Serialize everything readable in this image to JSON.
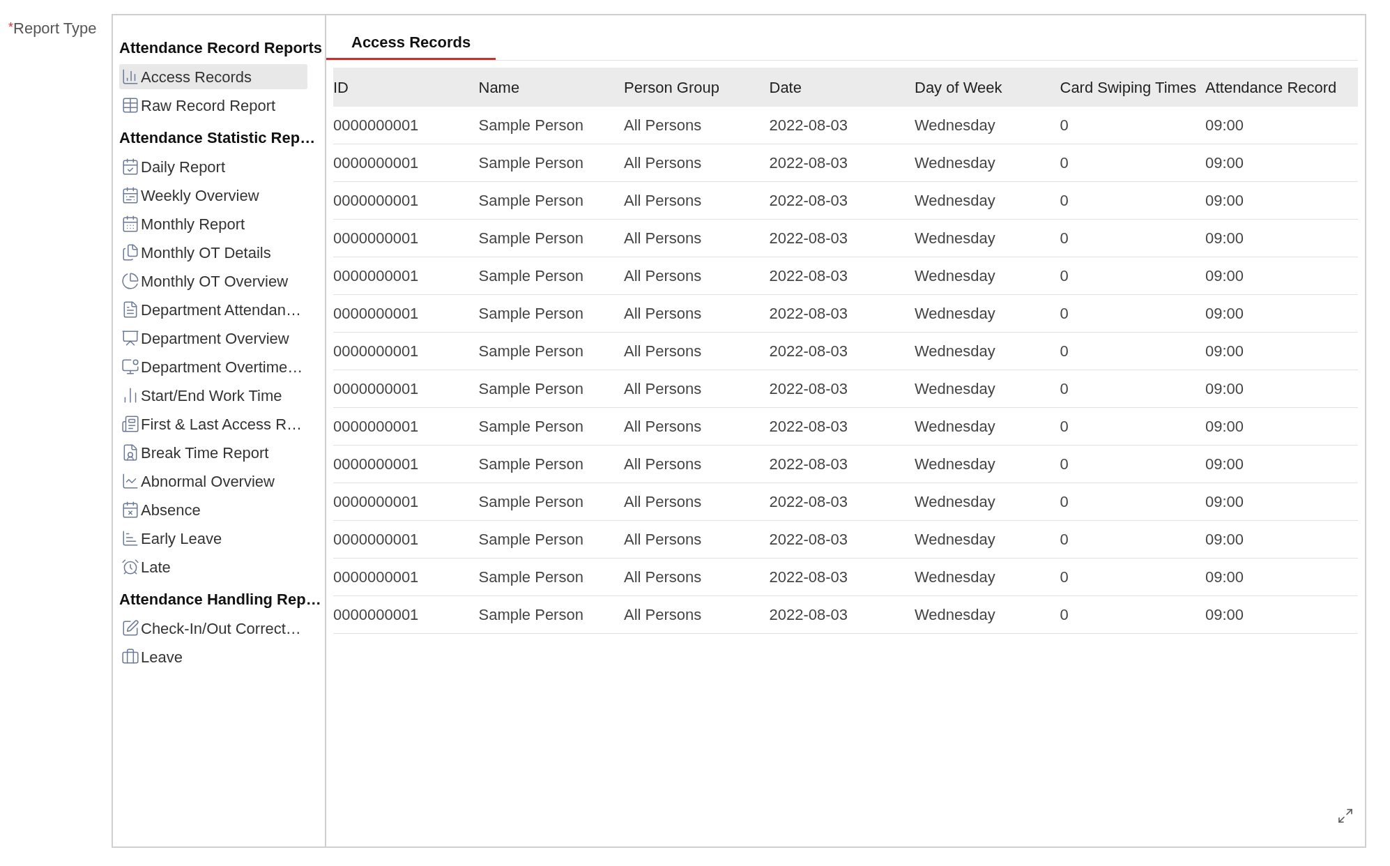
{
  "field_label": {
    "required_mark": "*",
    "text": "Report Type"
  },
  "sidebar": {
    "groups": [
      {
        "heading": "Attendance Record Reports",
        "items": [
          {
            "label": "Access Records",
            "selected": true
          },
          {
            "label": "Raw Record Report",
            "selected": false
          }
        ]
      },
      {
        "heading": "Attendance Statistic Rep…",
        "items": [
          {
            "label": "Daily Report",
            "selected": false
          },
          {
            "label": "Weekly Overview",
            "selected": false
          },
          {
            "label": "Monthly Report",
            "selected": false
          },
          {
            "label": "Monthly OT Details",
            "selected": false
          },
          {
            "label": "Monthly OT Overview",
            "selected": false
          },
          {
            "label": "Department Attendan…",
            "selected": false
          },
          {
            "label": "Department Overview",
            "selected": false
          },
          {
            "label": "Department Overtime…",
            "selected": false
          },
          {
            "label": "Start/End Work Time",
            "selected": false
          },
          {
            "label": "First & Last Access R…",
            "selected": false
          },
          {
            "label": "Break Time Report",
            "selected": false
          },
          {
            "label": "Abnormal Overview",
            "selected": false
          },
          {
            "label": "Absence",
            "selected": false
          },
          {
            "label": "Early Leave",
            "selected": false
          },
          {
            "label": "Late",
            "selected": false
          }
        ]
      },
      {
        "heading": "Attendance Handling Rep…",
        "items": [
          {
            "label": "Check-In/Out Correct…",
            "selected": false
          },
          {
            "label": "Leave",
            "selected": false
          }
        ]
      }
    ]
  },
  "tabs": [
    {
      "label": "Access Records",
      "selected": true
    }
  ],
  "table": {
    "columns": [
      "ID",
      "Name",
      "Person Group",
      "Date",
      "Day of Week",
      "Card Swiping Times",
      "Attendance Record"
    ],
    "rows": [
      [
        "0000000001",
        "Sample Person",
        "All Persons",
        "2022-08-03",
        "Wednesday",
        "0",
        "09:00"
      ],
      [
        "0000000001",
        "Sample Person",
        "All Persons",
        "2022-08-03",
        "Wednesday",
        "0",
        "09:00"
      ],
      [
        "0000000001",
        "Sample Person",
        "All Persons",
        "2022-08-03",
        "Wednesday",
        "0",
        "09:00"
      ],
      [
        "0000000001",
        "Sample Person",
        "All Persons",
        "2022-08-03",
        "Wednesday",
        "0",
        "09:00"
      ],
      [
        "0000000001",
        "Sample Person",
        "All Persons",
        "2022-08-03",
        "Wednesday",
        "0",
        "09:00"
      ],
      [
        "0000000001",
        "Sample Person",
        "All Persons",
        "2022-08-03",
        "Wednesday",
        "0",
        "09:00"
      ],
      [
        "0000000001",
        "Sample Person",
        "All Persons",
        "2022-08-03",
        "Wednesday",
        "0",
        "09:00"
      ],
      [
        "0000000001",
        "Sample Person",
        "All Persons",
        "2022-08-03",
        "Wednesday",
        "0",
        "09:00"
      ],
      [
        "0000000001",
        "Sample Person",
        "All Persons",
        "2022-08-03",
        "Wednesday",
        "0",
        "09:00"
      ],
      [
        "0000000001",
        "Sample Person",
        "All Persons",
        "2022-08-03",
        "Wednesday",
        "0",
        "09:00"
      ],
      [
        "0000000001",
        "Sample Person",
        "All Persons",
        "2022-08-03",
        "Wednesday",
        "0",
        "09:00"
      ],
      [
        "0000000001",
        "Sample Person",
        "All Persons",
        "2022-08-03",
        "Wednesday",
        "0",
        "09:00"
      ],
      [
        "0000000001",
        "Sample Person",
        "All Persons",
        "2022-08-03",
        "Wednesday",
        "0",
        "09:00"
      ],
      [
        "0000000001",
        "Sample Person",
        "All Persons",
        "2022-08-03",
        "Wednesday",
        "0",
        "09:00"
      ]
    ]
  }
}
